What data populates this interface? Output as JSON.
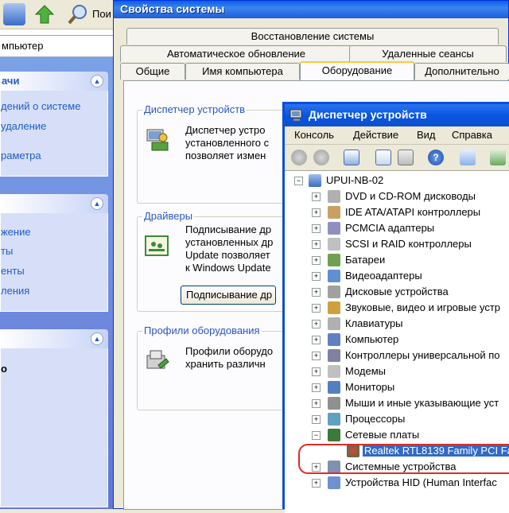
{
  "explorer": {
    "toolbar": {
      "search_label": "Пои"
    },
    "address": {
      "value": "мпьютер"
    },
    "sections": [
      {
        "title": "ачи",
        "links": [
          "дений о системе",
          "удаление",
          "",
          "раметра"
        ]
      },
      {
        "title": "",
        "links": [
          "жение",
          "ты",
          "енты",
          "ления"
        ]
      },
      {
        "title": "",
        "links": [
          "о"
        ]
      }
    ]
  },
  "sysprops": {
    "title": "Свойства системы",
    "tabs_row1": [
      "Восстановление системы"
    ],
    "tabs_row2": [
      "Автоматическое обновление",
      "Удаленные сеансы"
    ],
    "tabs_row3": [
      "Общие",
      "Имя компьютера",
      "Оборудование",
      "Дополнительно"
    ],
    "active_tab": "Оборудование",
    "groups": {
      "device_manager": {
        "label": "Диспетчер устройств",
        "text": "Диспетчер устро\nустановленного с\nпозволяет измен"
      },
      "drivers": {
        "label": "Драйверы",
        "text": "Подписывание др\nустановленных др\nUpdate позволяет\nк Windows Update",
        "button": "Подписывание др"
      },
      "profiles": {
        "label": "Профили оборудования",
        "text": "Профили оборудо\nхранить различн"
      }
    }
  },
  "devmgr": {
    "title": "Диспетчер устройств",
    "menu": [
      "Консоль",
      "Действие",
      "Вид",
      "Справка"
    ],
    "tree": {
      "root": "UPUI-NB-02",
      "categories": [
        "DVD и CD-ROM дисководы",
        "IDE ATA/ATAPI контроллеры",
        "PCMCIA адаптеры",
        "SCSI и RAID контроллеры",
        "Батареи",
        "Видеоадаптеры",
        "Дисковые устройства",
        "Звуковые, видео и игровые устр",
        "Клавиатуры",
        "Компьютер",
        "Контроллеры универсальной по",
        "Модемы",
        "Мониторы",
        "Мыши и иные указывающие уст",
        "Процессоры",
        "Сетевые платы",
        "Системные устройства",
        "Устройства HID (Human Interfac"
      ],
      "expanded_child": "Realtek RTL8139 Family PCI Fa"
    }
  },
  "colors": {
    "xp_title_blue": "#0a5fe8",
    "group_label": "#2a56c2",
    "selection": "#316ac5",
    "highlight_ring": "#e02a2a"
  }
}
